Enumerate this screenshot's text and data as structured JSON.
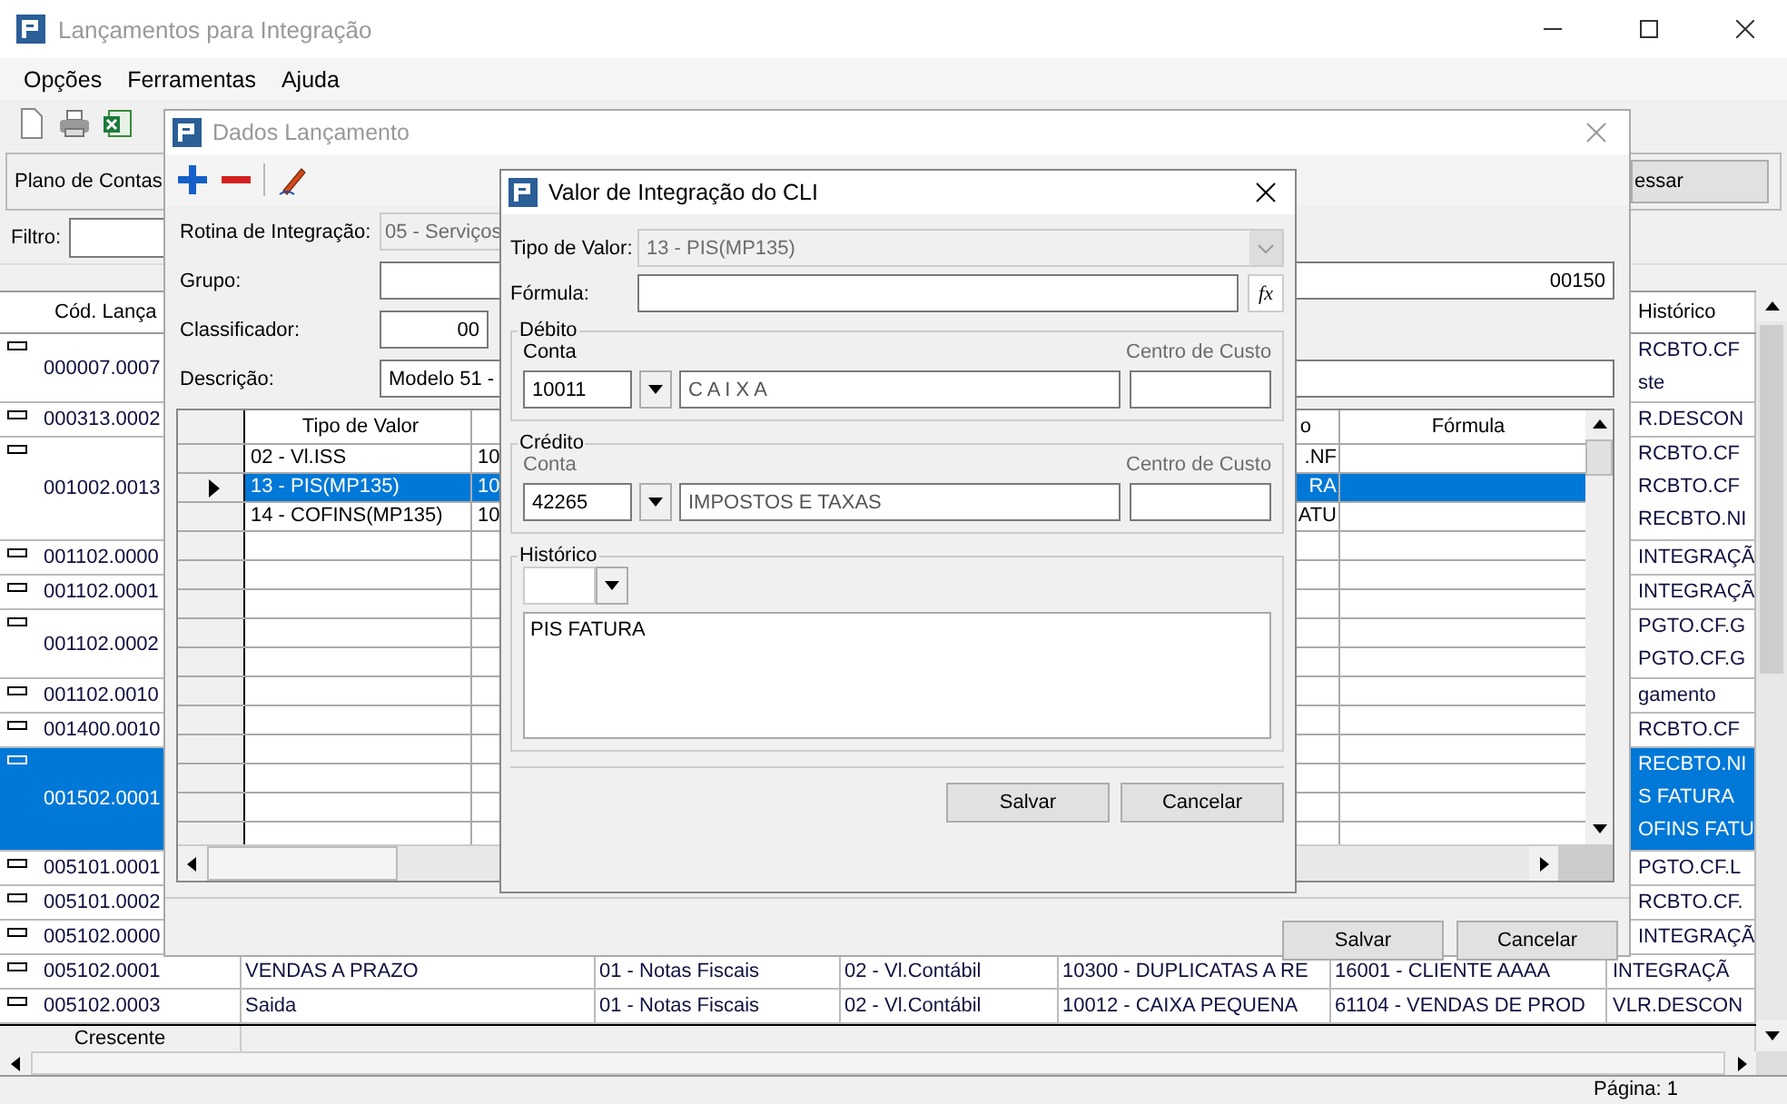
{
  "main_window": {
    "title": "Lançamentos para Integração",
    "menu": [
      "Opções",
      "Ferramentas",
      "Ajuda"
    ],
    "panel": {
      "label": "Plano de Contas",
      "button": "essar"
    },
    "filter": {
      "label": "Filtro:"
    },
    "table": {
      "columns": [
        "Cód. Lança",
        "Histórico"
      ],
      "rows": [
        {
          "kind": "covered",
          "code": "000007.0007",
          "historico": [
            "RCBTO.CF",
            "ste"
          ],
          "selected": false
        },
        {
          "kind": "covered",
          "code": "000313.0002",
          "historico": [
            "R.DESCON"
          ],
          "selected": false
        },
        {
          "kind": "covered",
          "code": "001002.0013",
          "historico": [
            "RCBTO.CF",
            "RCBTO.CF",
            "RECBTO.NI"
          ],
          "selected": false
        },
        {
          "kind": "covered",
          "code": "001102.0000",
          "historico": [
            "INTEGRAÇÃ"
          ],
          "selected": false
        },
        {
          "kind": "covered",
          "code": "001102.0001",
          "historico": [
            "INTEGRAÇÃ"
          ],
          "selected": false
        },
        {
          "kind": "covered",
          "code": "001102.0002",
          "historico": [
            "PGTO.CF.G",
            "PGTO.CF.G"
          ],
          "selected": false
        },
        {
          "kind": "covered",
          "code": "001102.0010",
          "historico": [
            "gamento"
          ],
          "selected": false
        },
        {
          "kind": "covered",
          "code": "001400.0010",
          "historico": [
            "RCBTO.CF"
          ],
          "selected": false
        },
        {
          "kind": "covered",
          "code": "001502.0001",
          "historico": [
            "RECBTO.NI",
            "S FATURA",
            "OFINS FATU"
          ],
          "selected": true
        },
        {
          "kind": "covered",
          "code": "005101.0001",
          "historico": [
            "PGTO.CF.L"
          ],
          "selected": false
        },
        {
          "kind": "covered",
          "code": "005101.0002",
          "historico": [
            "RCBTO.CF."
          ],
          "selected": false
        },
        {
          "kind": "covered",
          "code": "005102.0000",
          "historico": [
            "INTEGRAÇÃ"
          ],
          "selected": false
        },
        {
          "kind": "full",
          "code": "005102.0001",
          "cells": [
            "VENDAS A PRAZO",
            "01 - Notas Fiscais",
            "02 - Vl.Contábil",
            "10300 - DUPLICATAS A RE",
            "16001 - CLIENTE AAAA"
          ],
          "historico": [
            "INTEGRAÇÃ"
          ],
          "selected": false
        },
        {
          "kind": "full",
          "code": "005102.0003",
          "cells": [
            "Saida",
            "01 - Notas Fiscais",
            "02 - Vl.Contábil",
            "10012 - CAIXA PEQUENA",
            "61104 - VENDAS DE PROD"
          ],
          "historico": [
            "VLR.DESCON"
          ],
          "selected": false
        }
      ],
      "footer": "Crescente"
    },
    "status_bar": {
      "page": "Página: 1"
    }
  },
  "dados_dialog": {
    "title": "Dados Lançamento",
    "fields": [
      {
        "label": "Rotina de Integração:",
        "value": "05 - Serviços",
        "disabled": true,
        "kind": "wide"
      },
      {
        "label": "Grupo:",
        "value": "00150",
        "disabled": false,
        "kind": "long"
      },
      {
        "label": "Classificador:",
        "value": "00",
        "disabled": false,
        "kind": "short"
      },
      {
        "label": "Descrição:",
        "value": "Modelo 51 -",
        "disabled": false,
        "kind": "long"
      }
    ],
    "grid": {
      "columns": [
        "Tipo de Valor",
        "o",
        "Fórmula"
      ],
      "rows": [
        {
          "tipo": "02 - Vl.ISS",
          "column_3": "10",
          "column_4": ".NF",
          "selected": false
        },
        {
          "tipo": "13 - PIS(MP135)",
          "column_3": "10",
          "column_4": "RA",
          "selected": true
        },
        {
          "tipo": "14 - COFINS(MP135)",
          "column_3": "10",
          "column_4": "ATU",
          "selected": false
        }
      ]
    },
    "buttons": [
      "Salvar",
      "Cancelar"
    ]
  },
  "cli_dialog": {
    "title": "Valor de Integração do CLI",
    "tipo": {
      "label": "Tipo de Valor:",
      "value": "13 - PIS(MP135)",
      "disabled": true
    },
    "formula": {
      "label": "Fórmula:",
      "button": "fx"
    },
    "groups": [
      {
        "title": "Débito",
        "account_label": {
          "text": "Conta",
          "disabled": false
        },
        "account": "10011",
        "account_name": "C A I X A",
        "cost_center_label": {
          "text": "Centro de Custo",
          "disabled": true
        }
      },
      {
        "title": "Crédito",
        "account_label": {
          "text": "Conta",
          "disabled": true
        },
        "account": "42265",
        "account_name": "IMPOSTOS E TAXAS",
        "cost_center_label": {
          "text": "Centro de Custo",
          "disabled": true
        }
      }
    ],
    "historico": {
      "title": "Histórico",
      "text": "PIS FATURA"
    },
    "buttons": [
      "Salvar",
      "Cancelar"
    ]
  }
}
